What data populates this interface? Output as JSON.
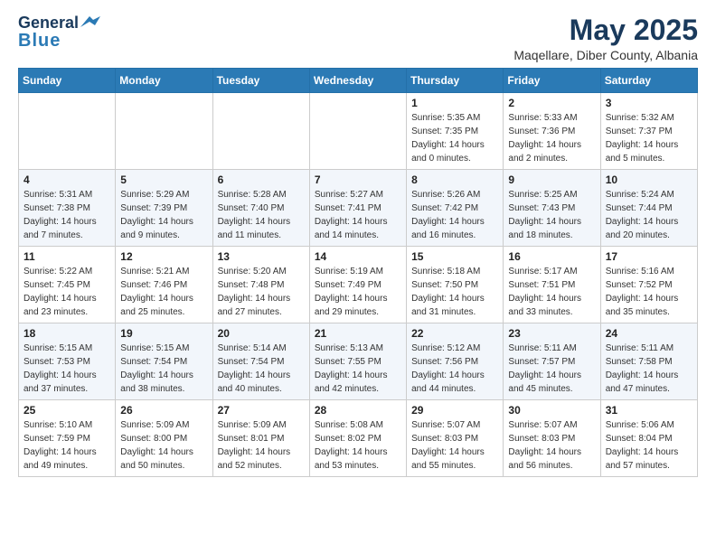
{
  "header": {
    "logo_line1": "General",
    "logo_line2": "Blue",
    "month": "May 2025",
    "location": "Maqellare, Diber County, Albania"
  },
  "weekdays": [
    "Sunday",
    "Monday",
    "Tuesday",
    "Wednesday",
    "Thursday",
    "Friday",
    "Saturday"
  ],
  "weeks": [
    [
      {
        "day": "",
        "info": ""
      },
      {
        "day": "",
        "info": ""
      },
      {
        "day": "",
        "info": ""
      },
      {
        "day": "",
        "info": ""
      },
      {
        "day": "1",
        "info": "Sunrise: 5:35 AM\nSunset: 7:35 PM\nDaylight: 14 hours\nand 0 minutes."
      },
      {
        "day": "2",
        "info": "Sunrise: 5:33 AM\nSunset: 7:36 PM\nDaylight: 14 hours\nand 2 minutes."
      },
      {
        "day": "3",
        "info": "Sunrise: 5:32 AM\nSunset: 7:37 PM\nDaylight: 14 hours\nand 5 minutes."
      }
    ],
    [
      {
        "day": "4",
        "info": "Sunrise: 5:31 AM\nSunset: 7:38 PM\nDaylight: 14 hours\nand 7 minutes."
      },
      {
        "day": "5",
        "info": "Sunrise: 5:29 AM\nSunset: 7:39 PM\nDaylight: 14 hours\nand 9 minutes."
      },
      {
        "day": "6",
        "info": "Sunrise: 5:28 AM\nSunset: 7:40 PM\nDaylight: 14 hours\nand 11 minutes."
      },
      {
        "day": "7",
        "info": "Sunrise: 5:27 AM\nSunset: 7:41 PM\nDaylight: 14 hours\nand 14 minutes."
      },
      {
        "day": "8",
        "info": "Sunrise: 5:26 AM\nSunset: 7:42 PM\nDaylight: 14 hours\nand 16 minutes."
      },
      {
        "day": "9",
        "info": "Sunrise: 5:25 AM\nSunset: 7:43 PM\nDaylight: 14 hours\nand 18 minutes."
      },
      {
        "day": "10",
        "info": "Sunrise: 5:24 AM\nSunset: 7:44 PM\nDaylight: 14 hours\nand 20 minutes."
      }
    ],
    [
      {
        "day": "11",
        "info": "Sunrise: 5:22 AM\nSunset: 7:45 PM\nDaylight: 14 hours\nand 23 minutes."
      },
      {
        "day": "12",
        "info": "Sunrise: 5:21 AM\nSunset: 7:46 PM\nDaylight: 14 hours\nand 25 minutes."
      },
      {
        "day": "13",
        "info": "Sunrise: 5:20 AM\nSunset: 7:48 PM\nDaylight: 14 hours\nand 27 minutes."
      },
      {
        "day": "14",
        "info": "Sunrise: 5:19 AM\nSunset: 7:49 PM\nDaylight: 14 hours\nand 29 minutes."
      },
      {
        "day": "15",
        "info": "Sunrise: 5:18 AM\nSunset: 7:50 PM\nDaylight: 14 hours\nand 31 minutes."
      },
      {
        "day": "16",
        "info": "Sunrise: 5:17 AM\nSunset: 7:51 PM\nDaylight: 14 hours\nand 33 minutes."
      },
      {
        "day": "17",
        "info": "Sunrise: 5:16 AM\nSunset: 7:52 PM\nDaylight: 14 hours\nand 35 minutes."
      }
    ],
    [
      {
        "day": "18",
        "info": "Sunrise: 5:15 AM\nSunset: 7:53 PM\nDaylight: 14 hours\nand 37 minutes."
      },
      {
        "day": "19",
        "info": "Sunrise: 5:15 AM\nSunset: 7:54 PM\nDaylight: 14 hours\nand 38 minutes."
      },
      {
        "day": "20",
        "info": "Sunrise: 5:14 AM\nSunset: 7:54 PM\nDaylight: 14 hours\nand 40 minutes."
      },
      {
        "day": "21",
        "info": "Sunrise: 5:13 AM\nSunset: 7:55 PM\nDaylight: 14 hours\nand 42 minutes."
      },
      {
        "day": "22",
        "info": "Sunrise: 5:12 AM\nSunset: 7:56 PM\nDaylight: 14 hours\nand 44 minutes."
      },
      {
        "day": "23",
        "info": "Sunrise: 5:11 AM\nSunset: 7:57 PM\nDaylight: 14 hours\nand 45 minutes."
      },
      {
        "day": "24",
        "info": "Sunrise: 5:11 AM\nSunset: 7:58 PM\nDaylight: 14 hours\nand 47 minutes."
      }
    ],
    [
      {
        "day": "25",
        "info": "Sunrise: 5:10 AM\nSunset: 7:59 PM\nDaylight: 14 hours\nand 49 minutes."
      },
      {
        "day": "26",
        "info": "Sunrise: 5:09 AM\nSunset: 8:00 PM\nDaylight: 14 hours\nand 50 minutes."
      },
      {
        "day": "27",
        "info": "Sunrise: 5:09 AM\nSunset: 8:01 PM\nDaylight: 14 hours\nand 52 minutes."
      },
      {
        "day": "28",
        "info": "Sunrise: 5:08 AM\nSunset: 8:02 PM\nDaylight: 14 hours\nand 53 minutes."
      },
      {
        "day": "29",
        "info": "Sunrise: 5:07 AM\nSunset: 8:03 PM\nDaylight: 14 hours\nand 55 minutes."
      },
      {
        "day": "30",
        "info": "Sunrise: 5:07 AM\nSunset: 8:03 PM\nDaylight: 14 hours\nand 56 minutes."
      },
      {
        "day": "31",
        "info": "Sunrise: 5:06 AM\nSunset: 8:04 PM\nDaylight: 14 hours\nand 57 minutes."
      }
    ]
  ]
}
